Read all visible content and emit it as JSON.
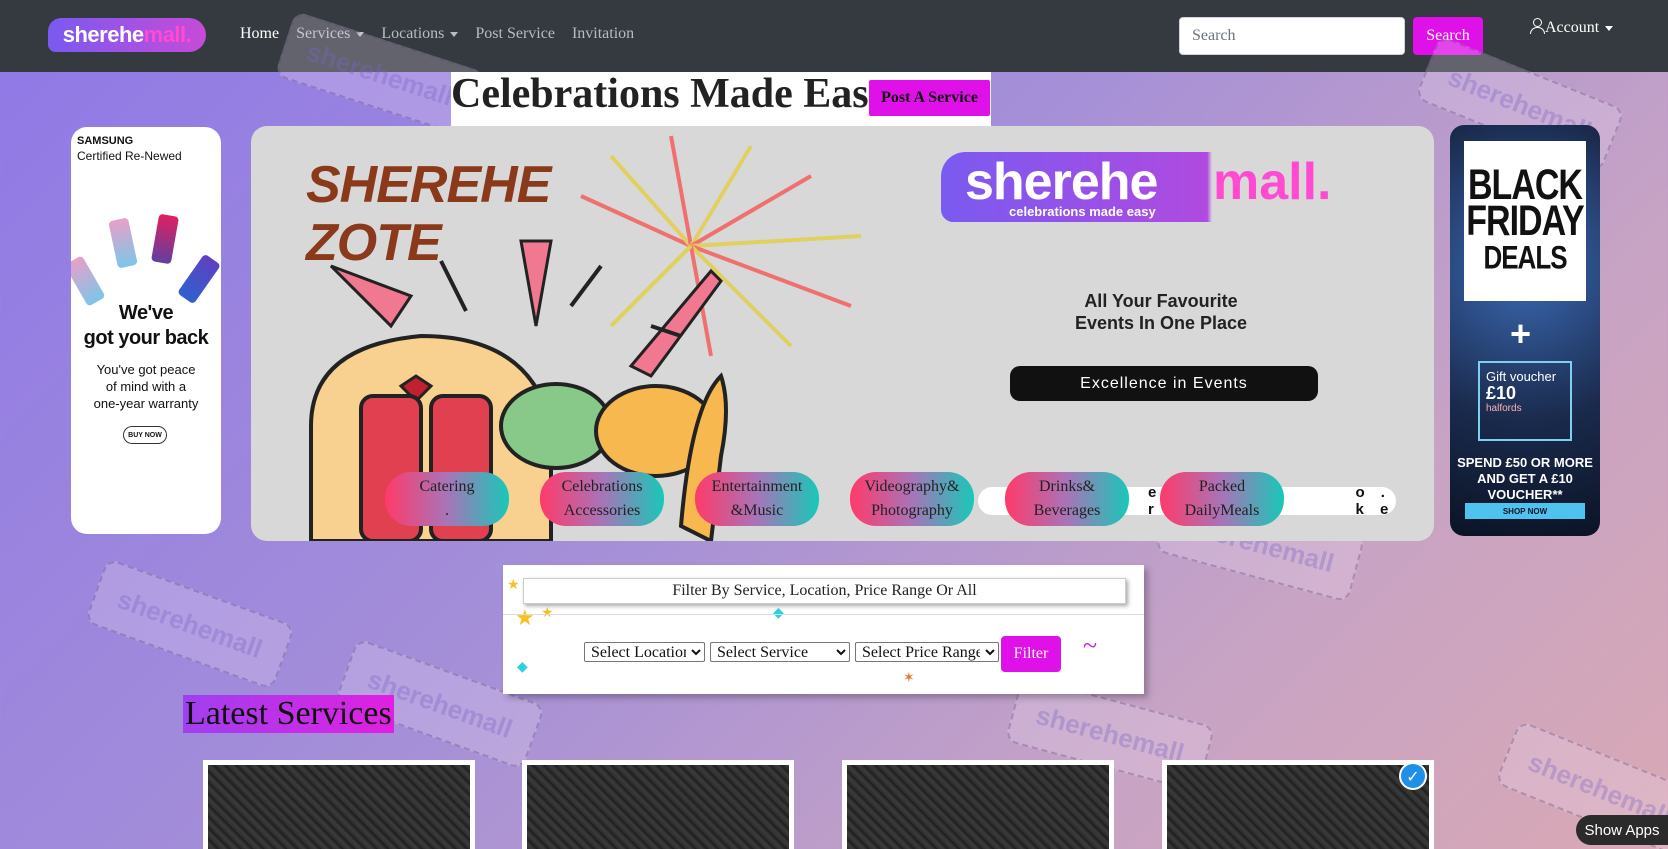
{
  "brand": {
    "logo_text_a": "sherehe",
    "logo_text_b": "mall."
  },
  "nav": {
    "home": "Home",
    "services": "Services",
    "locations": "Locations",
    "post_service": "Post Service",
    "invitation": "Invitation"
  },
  "search": {
    "placeholder": "Search",
    "button": "Search"
  },
  "account": {
    "label": "Account"
  },
  "headline": {
    "title": "Celebrations Made Easy",
    "post_button": "Post A Service"
  },
  "watermark": {
    "text_a": "sherehe",
    "text_b": "mall"
  },
  "ad_left": {
    "brand": "SAMSUNG",
    "cert": "Certified Re-Newed",
    "big_line_1": "We've",
    "big_line_2": "got your back",
    "small_1": "You've got peace",
    "small_2": "of mind with a",
    "small_3": "one-year warranty",
    "buy": "BUY NOW"
  },
  "ad_right": {
    "line1": "BLACK",
    "line2": "FRIDAY",
    "line3": "DEALS",
    "voucher_title": "Gift voucher",
    "voucher_amount": "£10",
    "voucher_brand": "halfords",
    "offer": "SPEND £50 OR MORE AND GET A £10 VOUCHER**",
    "shop": "SHOP NOW"
  },
  "hero": {
    "title_1": "SHEREHE",
    "title_2": "ZOTE",
    "logo_white": "sherehe",
    "logo_pink": "mall.",
    "logo_sub": "celebrations made easy",
    "tagline_1": "All Your Favourite",
    "tagline_2": "Events In One Place",
    "excellence": "Excellence in Events",
    "web_left": "e r",
    "web_right": "o . k e"
  },
  "categories": [
    {
      "line1": "Catering",
      "line2": "."
    },
    {
      "line1": "Celebrations",
      "line2": "Accessories"
    },
    {
      "line1": "Entertainment",
      "line2": "&Music"
    },
    {
      "line1": "Videography&",
      "line2": "Photography"
    },
    {
      "line1": "Drinks&",
      "line2": "Beverages"
    },
    {
      "line1": "Packed",
      "line2": "DailyMeals"
    }
  ],
  "filter": {
    "title": "Filter By Service, Location, Price Range Or All",
    "location": "Select Location",
    "service": "Select Service",
    "price": "Select Price Range",
    "button": "Filter"
  },
  "latest": {
    "title": "Latest Services"
  },
  "verified_icon": "✓",
  "show_apps": "Show Apps",
  "colors": {
    "accent": "#e010e8",
    "navbar": "#343a40"
  }
}
